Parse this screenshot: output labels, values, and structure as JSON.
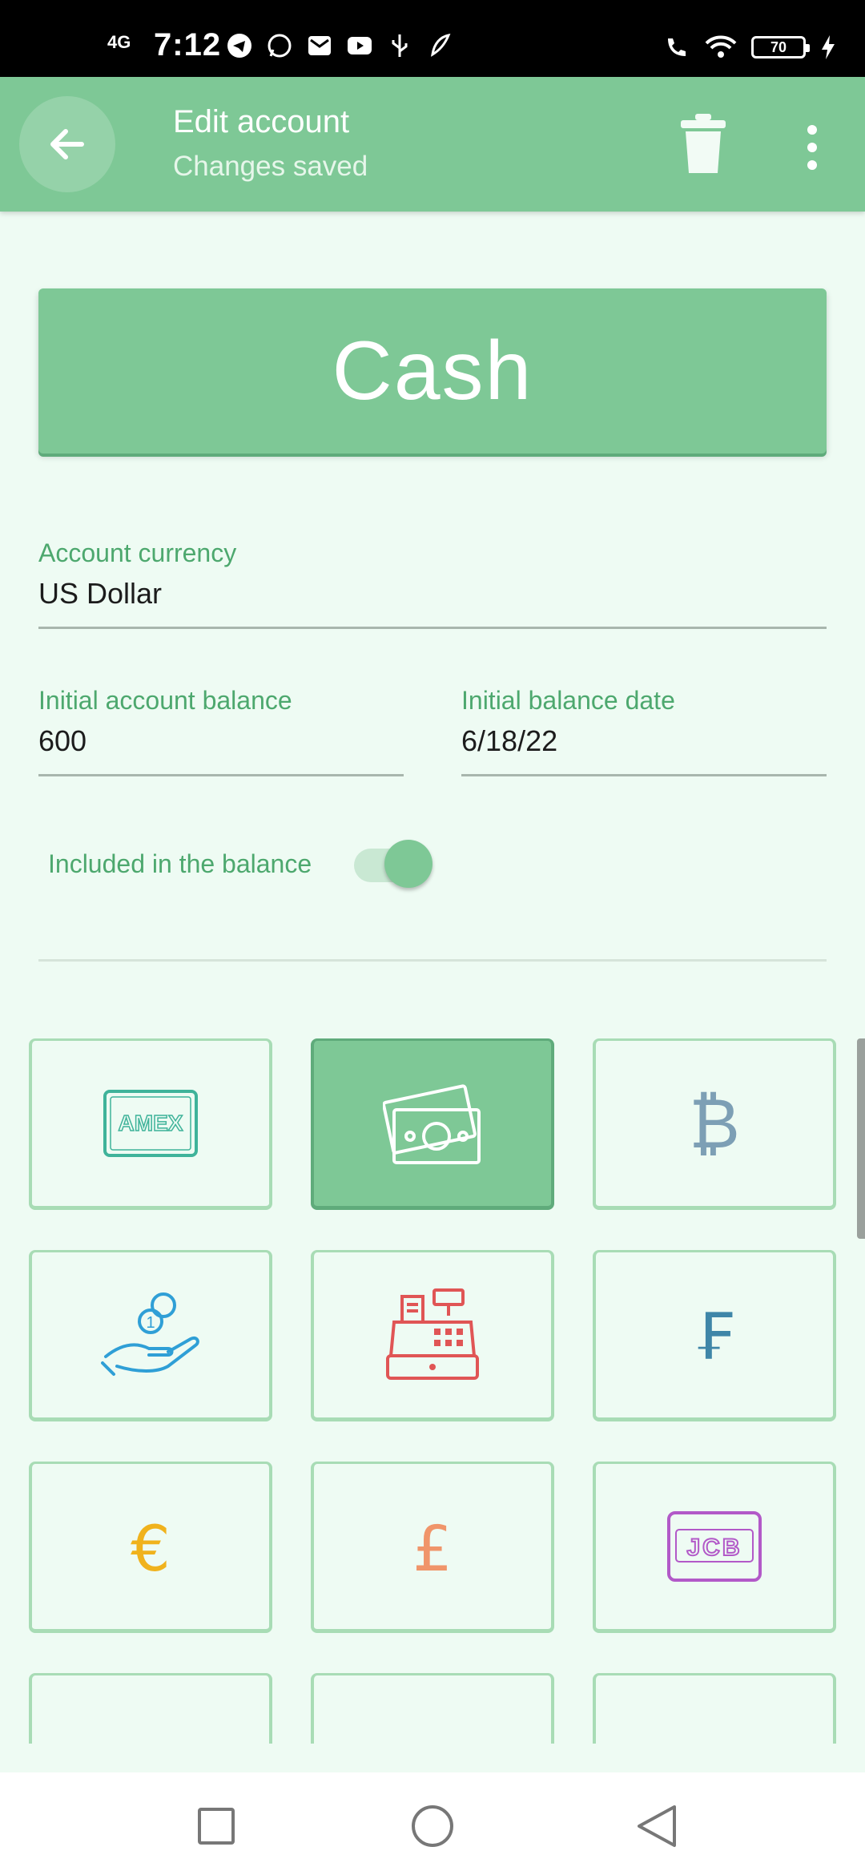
{
  "statusbar": {
    "network": "4G",
    "time": "7:12",
    "battery": "70"
  },
  "appbar": {
    "title": "Edit account",
    "subtitle": "Changes saved"
  },
  "account": {
    "name": "Cash",
    "currency_label": "Account currency",
    "currency_value": "US Dollar",
    "balance_label": "Initial account balance",
    "balance_value": "600",
    "date_label": "Initial balance date",
    "date_value": "6/18/22",
    "toggle_label": "Included in the balance",
    "toggle_on": true
  },
  "icons": [
    {
      "name": "amex-icon",
      "text": "AMEX",
      "color": "#3fb39a"
    },
    {
      "name": "cash-icon",
      "selected": true,
      "color": "#ffffff"
    },
    {
      "name": "bitcoin-icon",
      "text": "₿",
      "color": "#7d9fb5"
    },
    {
      "name": "coin-hand-icon",
      "text": "1",
      "color": "#2f9fd6"
    },
    {
      "name": "cash-register-icon",
      "color": "#e05555"
    },
    {
      "name": "franc-icon",
      "text": "₣",
      "color": "#3f86a8"
    },
    {
      "name": "euro-icon",
      "text": "€",
      "color": "#f0b21c"
    },
    {
      "name": "pound-icon",
      "text": "£",
      "color": "#f0956a"
    },
    {
      "name": "jcb-icon",
      "text": "JCB",
      "color": "#b259c8"
    }
  ]
}
